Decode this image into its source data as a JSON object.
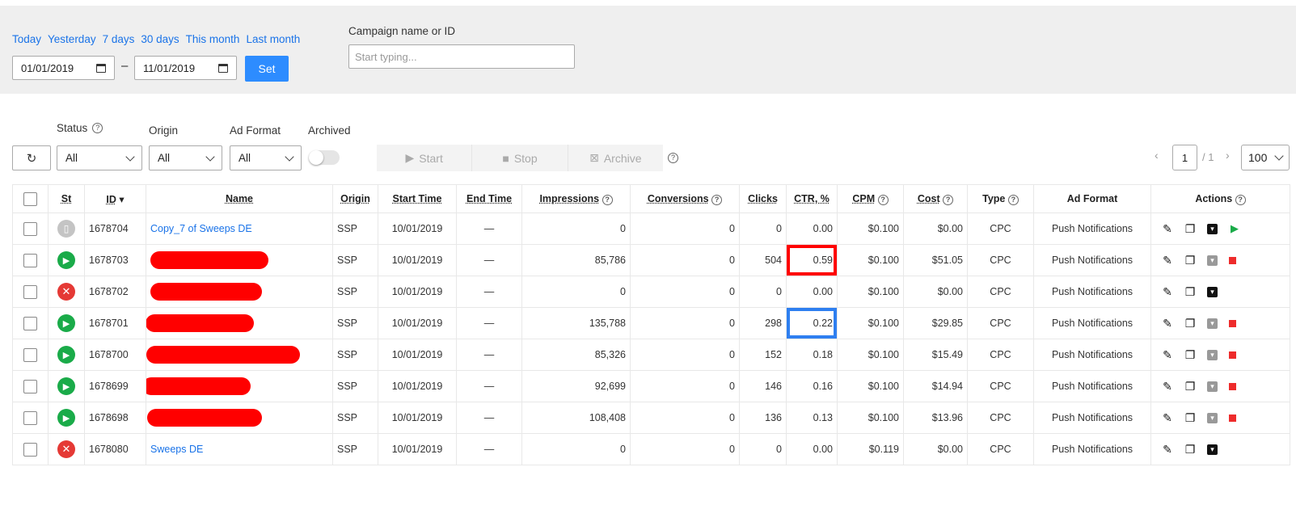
{
  "quick_ranges": [
    "Today",
    "Yesterday",
    "7 days",
    "30 days",
    "This month",
    "Last month"
  ],
  "date_from": "01/01/2019",
  "date_sep": "–",
  "date_to": "11/01/2019",
  "set_label": "Set",
  "campaign_search": {
    "label": "Campaign name or ID",
    "placeholder": "Start typing..."
  },
  "filters": {
    "status": {
      "label": "Status",
      "value": "All"
    },
    "origin": {
      "label": "Origin",
      "value": "All"
    },
    "ad_format": {
      "label": "Ad Format",
      "value": "All"
    },
    "archived": {
      "label": "Archived",
      "on": false
    }
  },
  "bulk_actions": {
    "start": "Start",
    "stop": "Stop",
    "archive": "Archive"
  },
  "pagination": {
    "page": "1",
    "total": "/ 1",
    "per_page": "100"
  },
  "columns": [
    "St",
    "ID",
    "Name",
    "Origin",
    "Start Time",
    "End Time",
    "Impressions",
    "Conversions",
    "Clicks",
    "CTR, %",
    "CPM",
    "Cost",
    "Type",
    "Ad Format",
    "Actions"
  ],
  "rows": [
    {
      "status": "draft",
      "id": "1678704",
      "name": "Copy_7 of Sweeps DE",
      "origin": "SSP",
      "start": "10/01/2019",
      "end": "—",
      "impressions": "0",
      "conversions": "0",
      "clicks": "0",
      "ctr": "0.00",
      "cpm": "$0.100",
      "cost": "$0.00",
      "type": "CPC",
      "format": "Push Notifications"
    },
    {
      "status": "active",
      "id": "1678703",
      "name": "",
      "origin": "SSP",
      "start": "10/01/2019",
      "end": "—",
      "impressions": "85,786",
      "conversions": "0",
      "clicks": "504",
      "ctr": "0.59",
      "cpm": "$0.100",
      "cost": "$51.05",
      "type": "CPC",
      "format": "Push Notifications"
    },
    {
      "status": "stopped",
      "id": "1678702",
      "name": "",
      "origin": "SSP",
      "start": "10/01/2019",
      "end": "—",
      "impressions": "0",
      "conversions": "0",
      "clicks": "0",
      "ctr": "0.00",
      "cpm": "$0.100",
      "cost": "$0.00",
      "type": "CPC",
      "format": "Push Notifications"
    },
    {
      "status": "active",
      "id": "1678701",
      "name": "",
      "origin": "SSP",
      "start": "10/01/2019",
      "end": "—",
      "impressions": "135,788",
      "conversions": "0",
      "clicks": "298",
      "ctr": "0.22",
      "cpm": "$0.100",
      "cost": "$29.85",
      "type": "CPC",
      "format": "Push Notifications"
    },
    {
      "status": "active",
      "id": "1678700",
      "name": "",
      "origin": "SSP",
      "start": "10/01/2019",
      "end": "—",
      "impressions": "85,326",
      "conversions": "0",
      "clicks": "152",
      "ctr": "0.18",
      "cpm": "$0.100",
      "cost": "$15.49",
      "type": "CPC",
      "format": "Push Notifications"
    },
    {
      "status": "active",
      "id": "1678699",
      "name": "",
      "origin": "SSP",
      "start": "10/01/2019",
      "end": "—",
      "impressions": "92,699",
      "conversions": "0",
      "clicks": "146",
      "ctr": "0.16",
      "cpm": "$0.100",
      "cost": "$14.94",
      "type": "CPC",
      "format": "Push Notifications"
    },
    {
      "status": "active",
      "id": "1678698",
      "name": "",
      "origin": "SSP",
      "start": "10/01/2019",
      "end": "—",
      "impressions": "108,408",
      "conversions": "0",
      "clicks": "136",
      "ctr": "0.13",
      "cpm": "$0.100",
      "cost": "$13.96",
      "type": "CPC",
      "format": "Push Notifications"
    },
    {
      "status": "stopped",
      "id": "1678080",
      "name": "Sweeps DE",
      "origin": "SSP",
      "start": "10/01/2019",
      "end": "—",
      "impressions": "0",
      "conversions": "0",
      "clicks": "0",
      "ctr": "0.00",
      "cpm": "$0.119",
      "cost": "$0.00",
      "type": "CPC",
      "format": "Push Notifications"
    }
  ],
  "colors": {
    "accent": "#2d8cff",
    "link": "#1a73e8",
    "active": "#1aab49",
    "stopped": "#e53935",
    "redaction": "#ff0000",
    "highlight_red": "#ff0000",
    "highlight_blue": "#2e7ff0"
  }
}
